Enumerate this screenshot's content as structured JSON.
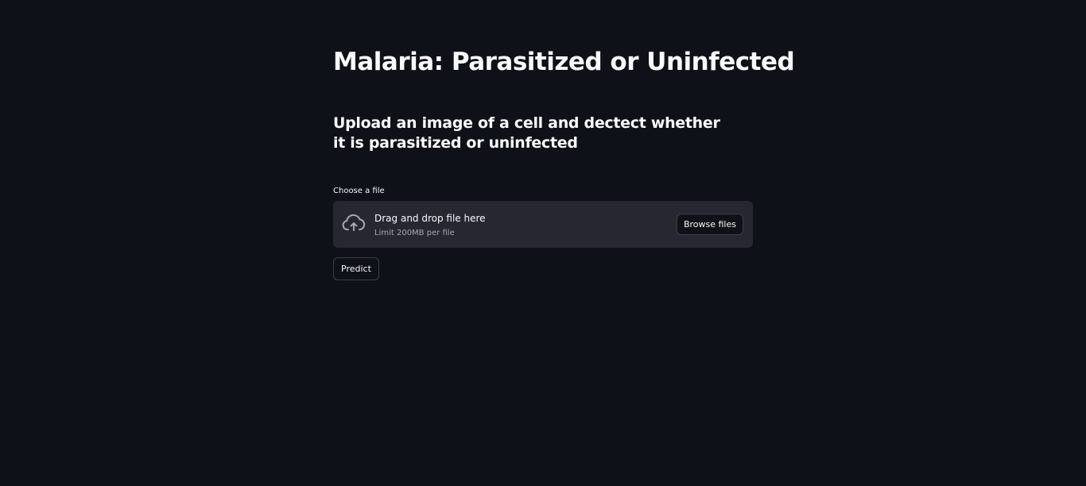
{
  "page": {
    "title": "Malaria: Parasitized or Uninfected",
    "subtitle": "Upload an image of a cell and dectect whether it is parasitized or uninfected"
  },
  "uploader": {
    "label": "Choose a file",
    "dropzone_title": "Drag and drop file here",
    "dropzone_limit": "Limit 200MB per file",
    "browse_label": "Browse files",
    "icon": "cloud-upload-icon"
  },
  "actions": {
    "predict_label": "Predict"
  },
  "colors": {
    "background": "#0e1117",
    "dropzone": "#262730",
    "text": "#fafafa",
    "muted_text": "#a3a8b8"
  }
}
